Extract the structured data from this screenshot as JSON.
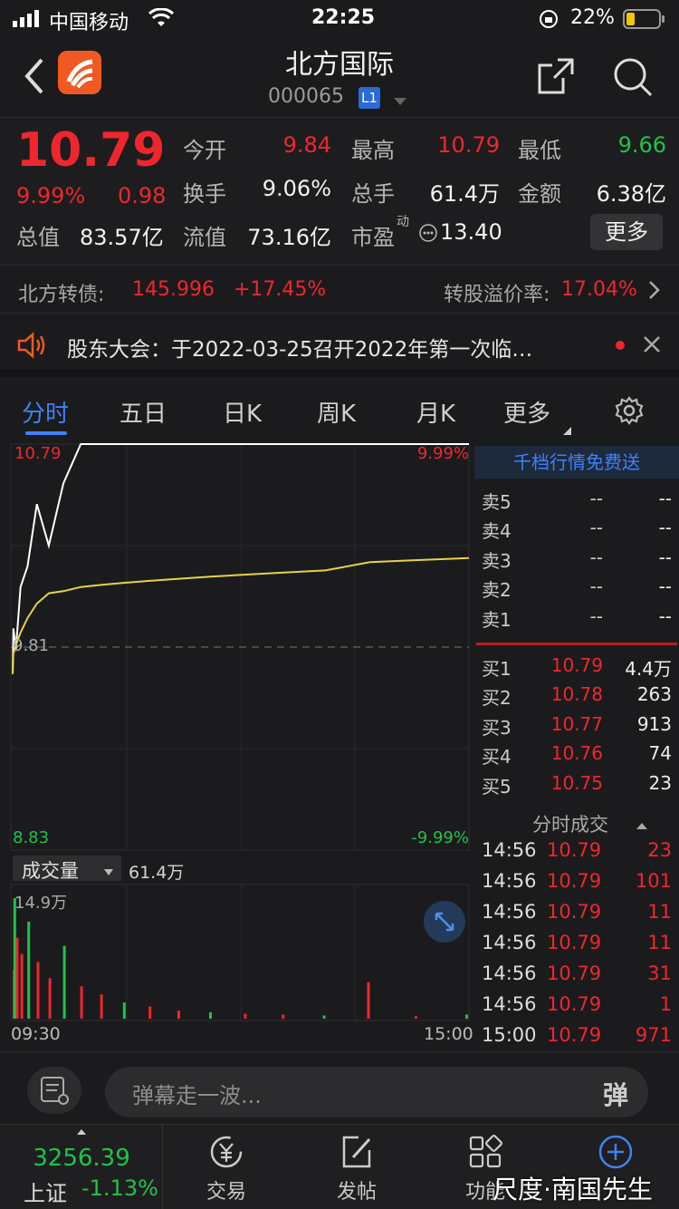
{
  "status_bar": {
    "carrier": "中国移动",
    "time": "22:25",
    "battery": "22%"
  },
  "header": {
    "title": "北方国际",
    "code": "000065",
    "level_badge": "L1",
    "logo_icon": "app-logo-icon"
  },
  "quote": {
    "price": "10.79",
    "change_pct": "9.99%",
    "change": "0.98",
    "labels": {
      "open": "今开",
      "high": "最高",
      "low": "最低",
      "turnover": "换手",
      "volume": "总手",
      "amount": "金额",
      "market_cap": "总值",
      "float_cap": "流值",
      "pe": "市盈",
      "pe_sup": "动"
    },
    "values": {
      "open": "9.84",
      "high": "10.79",
      "low": "9.66",
      "turnover": "9.06%",
      "volume": "61.4万",
      "amount": "6.38亿",
      "market_cap": "83.57亿",
      "float_cap": "73.16亿",
      "pe": "13.40"
    },
    "more_button": "更多"
  },
  "bond": {
    "name": "北方转债:",
    "price": "145.996",
    "change": "+17.45%",
    "premium_label": "转股溢价率:",
    "premium": "17.04%"
  },
  "notice": {
    "text": "股东大会：于2022-03-25召开2022年第一次临…"
  },
  "tabs": [
    {
      "label": "分时"
    },
    {
      "label": "五日"
    },
    {
      "label": "日K"
    },
    {
      "label": "周K"
    },
    {
      "label": "月K"
    },
    {
      "label": "更多"
    }
  ],
  "chart": {
    "price_high_label": "10.79",
    "price_mid_label": "9.81",
    "price_low_label": "8.83",
    "pct_high_label": "9.99%",
    "pct_low_label": "-9.99%",
    "volume_selector": "成交量",
    "volume_total": "61.4万",
    "volume_max_label": "14.9万",
    "time_start": "09:30",
    "time_end": "15:00",
    "colors": {
      "price_line": "#ffffff",
      "avg_line": "#e8d24a",
      "up": "#f0262e",
      "down": "#20c24a"
    }
  },
  "chart_data": {
    "type": "line",
    "series": [
      {
        "values": [
          9.68,
          9.9,
          9.8,
          10.1,
          10.2,
          10.5,
          10.3,
          10.6,
          10.79,
          10.79,
          10.79,
          10.79,
          10.79,
          10.79,
          10.79,
          10.79,
          10.79,
          10.79,
          10.79,
          10.79
        ]
      },
      {
        "values": [
          9.68,
          9.78,
          9.82,
          9.88,
          9.95,
          10.02,
          10.07,
          10.08,
          10.1,
          10.11,
          10.12,
          10.13,
          10.14,
          10.15,
          10.16,
          10.17,
          10.18,
          10.22,
          10.23,
          10.24
        ]
      }
    ],
    "ylim": [
      8.83,
      10.79
    ],
    "volume_values": [
      6,
      14.9,
      10,
      8,
      12,
      7,
      5,
      9,
      4,
      3,
      2,
      1.5,
      1,
      0.8,
      0.6,
      0.5,
      0.4,
      4.5,
      0.3,
      0.5
    ]
  },
  "orderbook": {
    "banner": "千档行情免费送",
    "asks": [
      {
        "label": "卖5",
        "price": "--",
        "vol": "--"
      },
      {
        "label": "卖4",
        "price": "--",
        "vol": "--"
      },
      {
        "label": "卖3",
        "price": "--",
        "vol": "--"
      },
      {
        "label": "卖2",
        "price": "--",
        "vol": "--"
      },
      {
        "label": "卖1",
        "price": "--",
        "vol": "--"
      }
    ],
    "bids": [
      {
        "label": "买1",
        "price": "10.79",
        "vol": "4.4万"
      },
      {
        "label": "买2",
        "price": "10.78",
        "vol": "263"
      },
      {
        "label": "买3",
        "price": "10.77",
        "vol": "913"
      },
      {
        "label": "买4",
        "price": "10.76",
        "vol": "74"
      },
      {
        "label": "买5",
        "price": "10.75",
        "vol": "23"
      }
    ],
    "trades_title": "分时成交",
    "trades": [
      {
        "time": "14:56",
        "price": "10.79",
        "vol": "23",
        "dir": "up"
      },
      {
        "time": "14:56",
        "price": "10.79",
        "vol": "101",
        "dir": "up"
      },
      {
        "time": "14:56",
        "price": "10.79",
        "vol": "11",
        "dir": "up"
      },
      {
        "time": "14:56",
        "price": "10.79",
        "vol": "11",
        "dir": "up"
      },
      {
        "time": "14:56",
        "price": "10.79",
        "vol": "31",
        "dir": "up"
      },
      {
        "time": "14:56",
        "price": "10.79",
        "vol": "1",
        "dir": "up"
      },
      {
        "time": "15:00",
        "price": "10.79",
        "vol": "971",
        "dir": "up"
      }
    ]
  },
  "danmu": {
    "placeholder": "弹幕走一波...",
    "danmu_button": "弹"
  },
  "bottom_nav": {
    "index_value": "3256.39",
    "index_name": "上证",
    "index_change": "-1.13%",
    "items": [
      {
        "label": "交易"
      },
      {
        "label": "发帖"
      },
      {
        "label": "功能"
      }
    ]
  },
  "watermark": "尺度·南国先生"
}
